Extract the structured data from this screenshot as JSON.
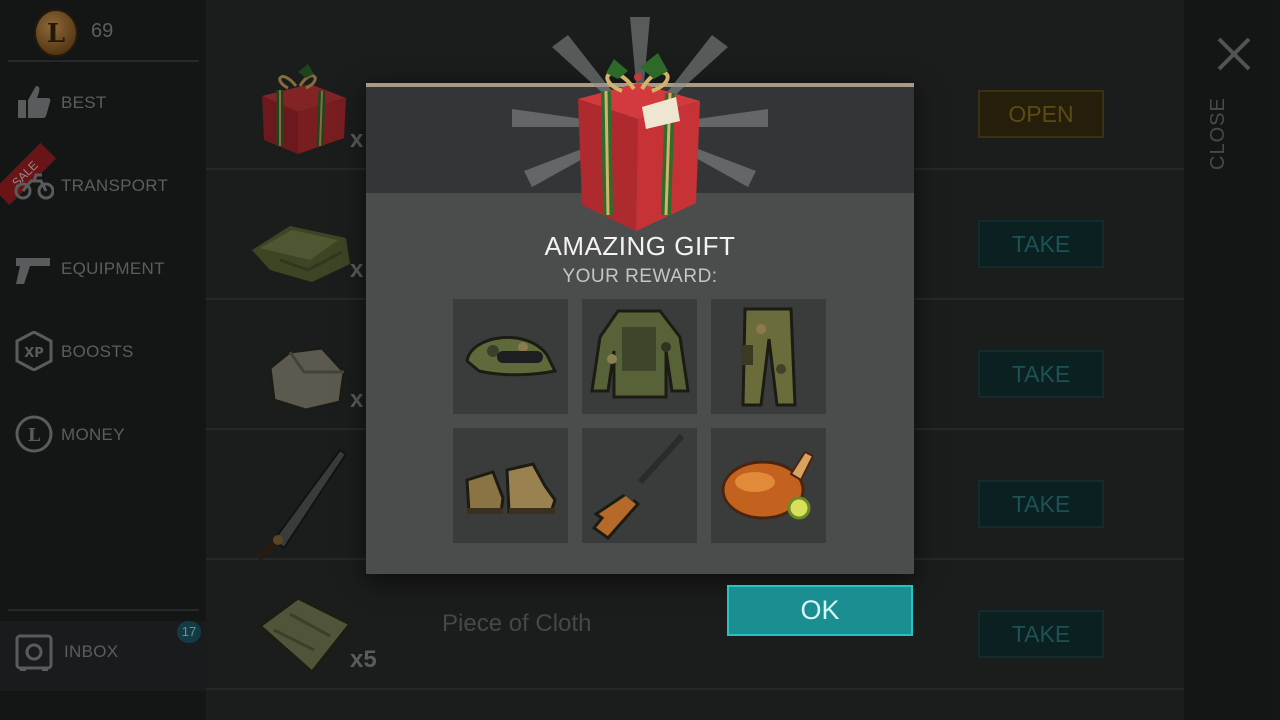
{
  "currency": {
    "icon": "coin-icon",
    "symbol": "L",
    "amount": "69"
  },
  "sidebar": {
    "items": [
      {
        "label": "BEST",
        "icon": "thumbs-up-icon"
      },
      {
        "label": "TRANSPORT",
        "icon": "motorcycle-icon",
        "badge": "SALE"
      },
      {
        "label": "EQUIPMENT",
        "icon": "pistol-icon"
      },
      {
        "label": "BOOSTS",
        "icon": "xp-icon",
        "icon_text": "XP"
      },
      {
        "label": "MONEY",
        "icon": "coin-icon",
        "icon_text": "L"
      }
    ],
    "inbox": {
      "label": "INBOX",
      "icon": "safe-icon",
      "count": "17"
    }
  },
  "list": {
    "rows": [
      {
        "icon": "gift-box-icon",
        "qty": "x",
        "name": "",
        "action": "OPEN"
      },
      {
        "icon": "cloth-stack-icon",
        "qty": "x",
        "name": "",
        "action": "TAKE"
      },
      {
        "icon": "stone-icon",
        "qty": "x",
        "name": "",
        "action": "TAKE"
      },
      {
        "icon": "machete-icon",
        "qty": "",
        "name": "",
        "action": "TAKE"
      },
      {
        "icon": "cloth-piece-icon",
        "qty": "x5",
        "name": "Piece of Cloth",
        "action": "TAKE"
      }
    ]
  },
  "close": {
    "label": "CLOSE",
    "icon": "close-icon"
  },
  "modal": {
    "icon": "gift-box-icon",
    "title": "AMAZING GIFT",
    "subtitle": "YOUR REWARD:",
    "rewards": [
      {
        "icon": "camo-cap-icon"
      },
      {
        "icon": "camo-jacket-icon"
      },
      {
        "icon": "camo-pants-icon"
      },
      {
        "icon": "boots-icon"
      },
      {
        "icon": "rifle-icon"
      },
      {
        "icon": "roast-chicken-icon"
      }
    ],
    "ok_label": "OK"
  },
  "colors": {
    "ok_button": "#1a8e90",
    "take_button": "#103234",
    "open_button": "#3a2f12",
    "modal_bg": "#4b4d4c"
  }
}
